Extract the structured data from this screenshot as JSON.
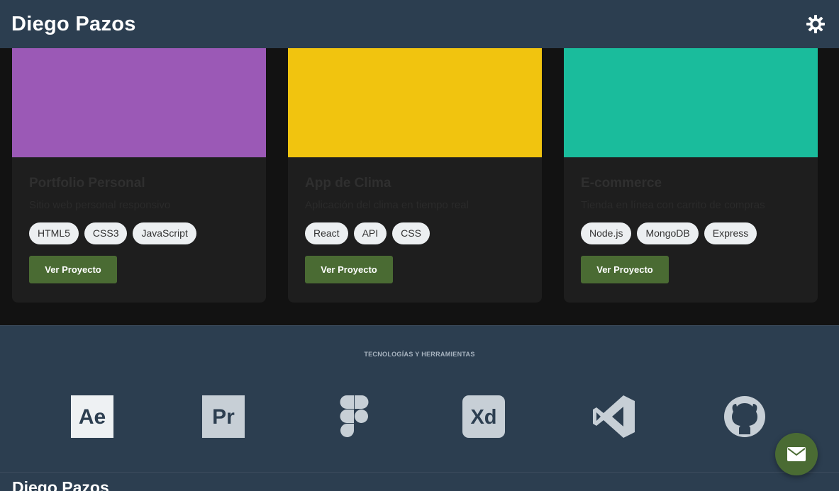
{
  "header": {
    "brand": "Diego Pazos",
    "theme_toggle_icon": "gear-sun-icon"
  },
  "projects": [
    {
      "title": "Portfolio Personal",
      "description": "Sitio web personal responsivo",
      "color": "#9b59b6",
      "tags": [
        "HTML5",
        "CSS3",
        "JavaScript"
      ],
      "button": "Ver Proyecto"
    },
    {
      "title": "App de Clima",
      "description": "Aplicación del clima en tiempo real",
      "color": "#f1c40f",
      "tags": [
        "React",
        "API",
        "CSS"
      ],
      "button": "Ver Proyecto"
    },
    {
      "title": "E-commerce",
      "description": "Tienda en línea con carrito de compras",
      "color": "#1abc9c",
      "tags": [
        "Node.js",
        "MongoDB",
        "Express"
      ],
      "button": "Ver Proyecto"
    }
  ],
  "tech": {
    "heading": "TECNOLOGÍAS Y HERRAMIENTAS",
    "icons": [
      {
        "name": "after-effects-icon",
        "label": "Ae"
      },
      {
        "name": "premiere-icon",
        "label": "Pr"
      },
      {
        "name": "figma-icon"
      },
      {
        "name": "adobe-xd-icon",
        "label": "Xd"
      },
      {
        "name": "vscode-icon"
      },
      {
        "name": "github-icon"
      }
    ]
  },
  "footer": {
    "name": "Diego Pazos"
  },
  "fab": {
    "icon": "envelope-icon"
  },
  "colors": {
    "header_bg": "#2c3e50",
    "button_green": "#4a6b33",
    "page_bg": "#121212",
    "card_bg": "#1e1e1e"
  }
}
